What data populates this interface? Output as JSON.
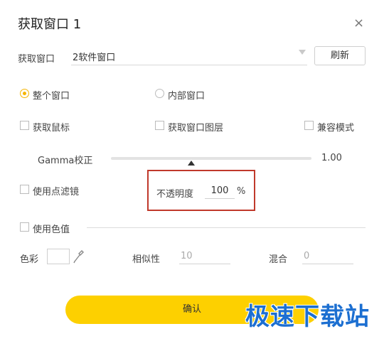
{
  "dialog": {
    "title": "获取窗口 1",
    "close_symbol": "×"
  },
  "capture": {
    "label": "获取窗口",
    "selected_window": "2软件窗口",
    "refresh_label": "刷新"
  },
  "mode": {
    "whole_window": "整个窗口",
    "inner_window": "内部窗口",
    "selected": "whole_window"
  },
  "options": {
    "capture_mouse": "获取鼠标",
    "capture_layers": "获取窗口图层",
    "compat_mode": "兼容模式"
  },
  "gamma": {
    "label": "Gamma校正",
    "value_text": "1.00",
    "level": 0.4
  },
  "filter": {
    "label": "使用点滤镜"
  },
  "opacity": {
    "label": "不透明度",
    "value": "100",
    "unit": "%"
  },
  "color_key": {
    "label": "使用色值",
    "color_label": "色彩",
    "similarity_label": "相似性",
    "similarity_value": "10",
    "blend_label": "混合",
    "blend_value": "0"
  },
  "confirm_label": "确认",
  "watermark": "极速下载站",
  "colors": {
    "accent": "#fdd000",
    "radio_on": "#f5b400",
    "highlight_box": "#c0392b",
    "watermark": "#1c6fd1"
  }
}
